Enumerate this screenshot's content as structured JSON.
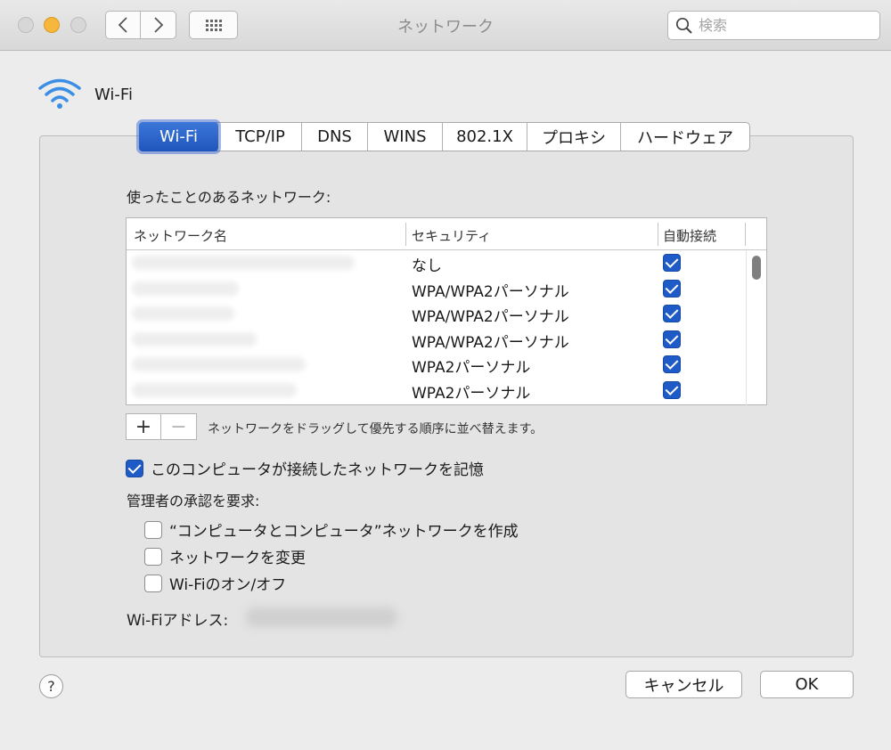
{
  "window": {
    "title": "ネットワーク",
    "search_placeholder": "検索"
  },
  "header": {
    "label": "Wi-Fi"
  },
  "tabs": [
    {
      "label": "Wi-Fi",
      "active": true
    },
    {
      "label": "TCP/IP",
      "active": false
    },
    {
      "label": "DNS",
      "active": false
    },
    {
      "label": "WINS",
      "active": false
    },
    {
      "label": "802.1X",
      "active": false
    },
    {
      "label": "プロキシ",
      "active": false
    },
    {
      "label": "ハードウェア",
      "active": false
    }
  ],
  "networks": {
    "section_title": "使ったことのあるネットワーク:",
    "columns": {
      "name": "ネットワーク名",
      "security": "セキュリティ",
      "auto": "自動接続"
    },
    "rows": [
      {
        "security": "なし",
        "auto_join": true
      },
      {
        "security": "WPA/WPA2パーソナル",
        "auto_join": true
      },
      {
        "security": "WPA/WPA2パーソナル",
        "auto_join": true
      },
      {
        "security": "WPA/WPA2パーソナル",
        "auto_join": true
      },
      {
        "security": "WPA2パーソナル",
        "auto_join": true
      },
      {
        "security": "WPA2パーソナル",
        "auto_join": true
      }
    ],
    "add_label": "+",
    "remove_label": "−",
    "reorder_hint": "ネットワークをドラッグして優先する順序に並べ替えます。"
  },
  "options": {
    "remember_label": "このコンピュータが接続したネットワークを記憶",
    "remember_checked": true,
    "admin_title": "管理者の承認を要求:",
    "admin_items": [
      {
        "label": "“コンピュータとコンピュータ”ネットワークを作成",
        "checked": false
      },
      {
        "label": "ネットワークを変更",
        "checked": false
      },
      {
        "label": "Wi-Fiのオン/オフ",
        "checked": false
      }
    ]
  },
  "address": {
    "label": "Wi-Fiアドレス:"
  },
  "footer": {
    "help_label": "?",
    "cancel_label": "キャンセル",
    "ok_label": "OK"
  },
  "colors": {
    "accent": "#1e5bc6",
    "minimize": "#f6b73c"
  }
}
